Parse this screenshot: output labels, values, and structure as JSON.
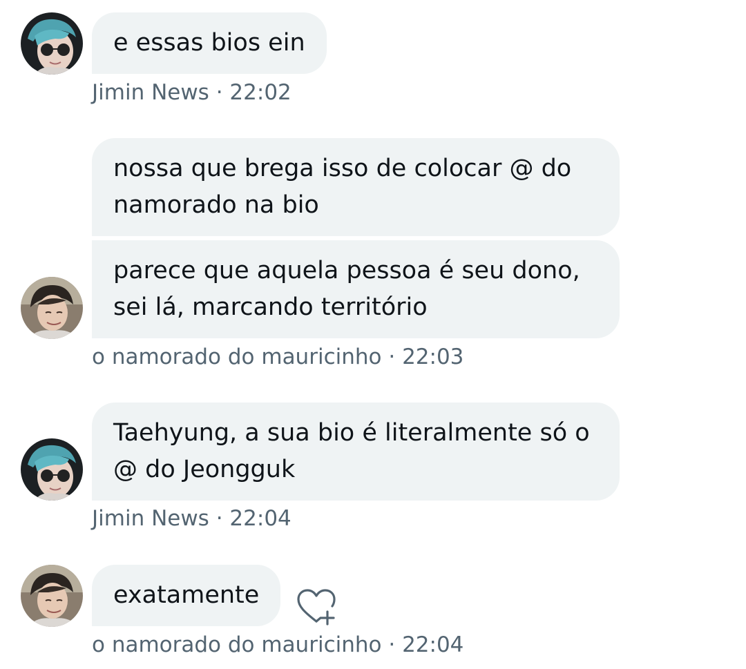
{
  "messages": [
    {
      "text": "e essas bios ein",
      "sender": "Jimin News",
      "time": "22:02"
    },
    {
      "text": "nossa que brega isso de colocar @ do namorado na bio",
      "sender": "",
      "time": ""
    },
    {
      "text": "parece que aquela pessoa é seu dono, sei lá, marcando território",
      "sender": "o namorado do mauricinho",
      "time": "22:03"
    },
    {
      "text": "Taehyung, a sua bio é literalmente só o @ do Jeongguk",
      "sender": "Jimin News",
      "time": "22:04"
    },
    {
      "text": "exatamente",
      "sender": "o namorado do mauricinho",
      "time": "22:04"
    }
  ],
  "separator": "·",
  "icons": {
    "heart_add": "heart-plus-icon",
    "avatar_a": "avatar-jimin-news",
    "avatar_b": "avatar-namorado"
  },
  "colors": {
    "bubble": "#eff3f4",
    "meta_text": "#536471",
    "text": "#0f1419"
  }
}
